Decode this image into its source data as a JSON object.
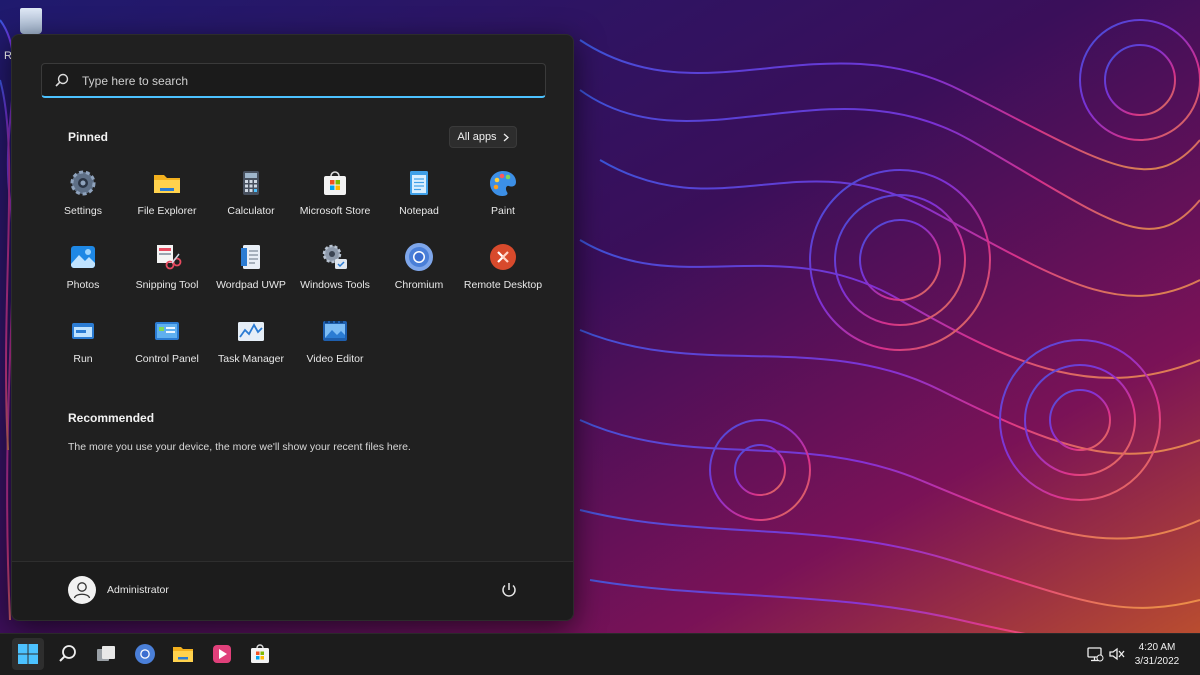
{
  "desktop": {
    "icon_label": "R"
  },
  "search": {
    "placeholder": "Type here to search"
  },
  "pinned": {
    "title": "Pinned",
    "all_apps_label": "All apps",
    "apps": [
      {
        "label": "Settings",
        "icon": "settings-icon"
      },
      {
        "label": "File Explorer",
        "icon": "file-explorer-icon"
      },
      {
        "label": "Calculator",
        "icon": "calculator-icon"
      },
      {
        "label": "Microsoft Store",
        "icon": "microsoft-store-icon"
      },
      {
        "label": "Notepad",
        "icon": "notepad-icon"
      },
      {
        "label": "Paint",
        "icon": "paint-icon"
      },
      {
        "label": "Photos",
        "icon": "photos-icon"
      },
      {
        "label": "Snipping Tool",
        "icon": "snipping-tool-icon"
      },
      {
        "label": "Wordpad UWP",
        "icon": "wordpad-icon"
      },
      {
        "label": "Windows Tools",
        "icon": "windows-tools-icon"
      },
      {
        "label": "Chromium",
        "icon": "chromium-icon"
      },
      {
        "label": "Remote Desktop",
        "icon": "remote-desktop-icon"
      },
      {
        "label": "Run",
        "icon": "run-icon"
      },
      {
        "label": "Control Panel",
        "icon": "control-panel-icon"
      },
      {
        "label": "Task Manager",
        "icon": "task-manager-icon"
      },
      {
        "label": "Video Editor",
        "icon": "video-editor-icon"
      }
    ]
  },
  "recommended": {
    "title": "Recommended",
    "empty_text": "The more you use your device, the more we'll show your recent files here."
  },
  "user": {
    "name": "Administrator"
  },
  "taskbar": {
    "time": "4:20 AM",
    "date": "3/31/2022"
  },
  "colors": {
    "accent": "#4cc2ff",
    "menu_bg": "#202020",
    "taskbar_bg": "#1c1c1c"
  }
}
